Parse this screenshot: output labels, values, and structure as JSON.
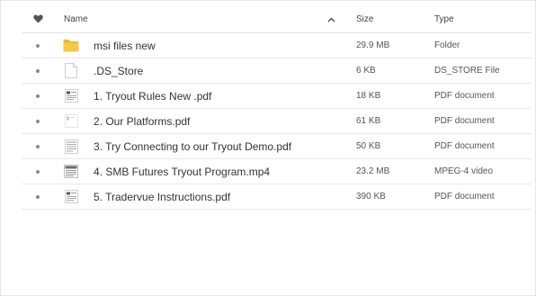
{
  "header": {
    "favorite_icon": "heart-icon",
    "name_label": "Name",
    "sort_icon": "chevron-up-icon",
    "size_label": "Size",
    "type_label": "Type"
  },
  "files": [
    {
      "name": "msi files new",
      "size": "29.9 MB",
      "type": "Folder",
      "icon": "folder-icon"
    },
    {
      "name": ".DS_Store",
      "size": "6 KB",
      "type": "DS_STORE File",
      "icon": "file-icon"
    },
    {
      "name": "1. Tryout Rules New .pdf",
      "size": "18 KB",
      "type": "PDF document",
      "icon": "pdf-thumbnail-icon"
    },
    {
      "name": "2. Our Platforms.pdf",
      "size": "61 KB",
      "type": "PDF document",
      "icon": "pdf-thumbnail-icon"
    },
    {
      "name": "3. Try Connecting to our Tryout Demo.pdf",
      "size": "50 KB",
      "type": "PDF document",
      "icon": "pdf-thumbnail-icon"
    },
    {
      "name": "4. SMB Futures Tryout Program.mp4",
      "size": "23.2 MB",
      "type": "MPEG-4 video",
      "icon": "video-thumbnail-icon"
    },
    {
      "name": "5. Tradervue Instructions.pdf",
      "size": "390 KB",
      "type": "PDF document",
      "icon": "pdf-thumbnail-icon"
    }
  ],
  "colors": {
    "folder": "#f5c84c",
    "folder_dark": "#e8b63a",
    "border": "#e8e8e8",
    "dot": "#8a8a8a"
  }
}
